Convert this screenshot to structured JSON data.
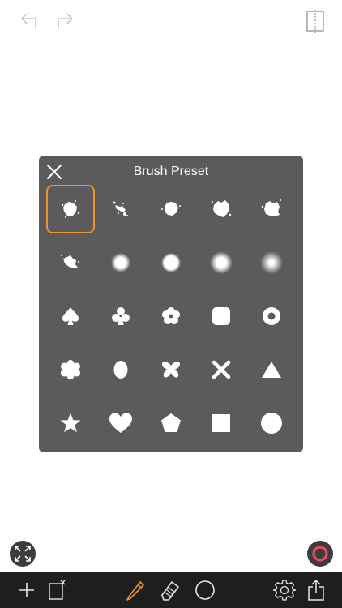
{
  "panel": {
    "title": "Brush Preset"
  },
  "presets": [
    {
      "icon": "splatter-brush-1-icon",
      "selected": true
    },
    {
      "icon": "splatter-brush-2-icon",
      "selected": false
    },
    {
      "icon": "splatter-brush-3-icon",
      "selected": false
    },
    {
      "icon": "splatter-brush-4-icon",
      "selected": false
    },
    {
      "icon": "splatter-brush-5-icon",
      "selected": false
    },
    {
      "icon": "splatter-brush-6-icon",
      "selected": false
    },
    {
      "icon": "soft-brush-1-icon",
      "selected": false
    },
    {
      "icon": "soft-brush-2-icon",
      "selected": false
    },
    {
      "icon": "soft-brush-3-icon",
      "selected": false
    },
    {
      "icon": "soft-brush-4-icon",
      "selected": false
    },
    {
      "icon": "spade-icon",
      "selected": false
    },
    {
      "icon": "club-icon",
      "selected": false
    },
    {
      "icon": "flower-icon",
      "selected": false
    },
    {
      "icon": "rounded-square-icon",
      "selected": false
    },
    {
      "icon": "ring-icon",
      "selected": false
    },
    {
      "icon": "cloud-flower-icon",
      "selected": false
    },
    {
      "icon": "ellipse-icon",
      "selected": false
    },
    {
      "icon": "butterfly-icon",
      "selected": false
    },
    {
      "icon": "cross-icon",
      "selected": false
    },
    {
      "icon": "triangle-icon",
      "selected": false
    },
    {
      "icon": "star-icon",
      "selected": false
    },
    {
      "icon": "heart-icon",
      "selected": false
    },
    {
      "icon": "pentagon-icon",
      "selected": false
    },
    {
      "icon": "square-icon",
      "selected": false
    },
    {
      "icon": "circle-icon",
      "selected": false
    }
  ],
  "colors": {
    "accent": "#f0932b",
    "panel": "#5b5b5b",
    "toolbar": "#1e1e1e",
    "record": "#e84a5f"
  }
}
